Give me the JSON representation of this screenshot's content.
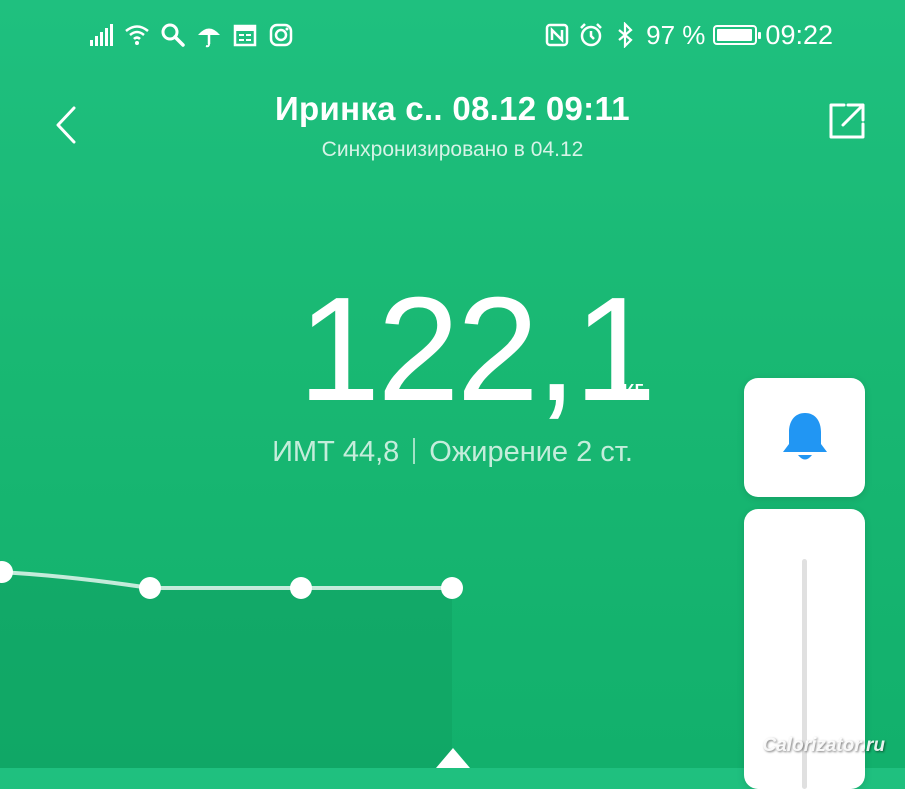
{
  "status_bar": {
    "left_icons": [
      "signal-icon",
      "wifi-icon",
      "search-icon",
      "umbrella-icon",
      "calendar-icon",
      "instagram-icon"
    ],
    "right_icons": [
      "nfc-icon",
      "alarm-icon",
      "bluetooth-icon"
    ],
    "battery_text": "97 %",
    "battery_level": 0.97,
    "time": "09:22"
  },
  "header": {
    "title": "Иринка с.. 08.12 09:11",
    "subtitle": "Синхронизировано в 04.12",
    "back_icon": "chevron-left-icon",
    "share_icon": "share-icon"
  },
  "measurement": {
    "weight": "122,1",
    "unit": "кг",
    "bmi": "ИМТ 44,8",
    "category": "Ожирение 2 ст."
  },
  "side_panel": {
    "bell_icon": "bell-icon",
    "accent": "#2196f3"
  },
  "colors": {
    "background": "#19b873"
  },
  "watermark": "Calorizator.ru"
}
